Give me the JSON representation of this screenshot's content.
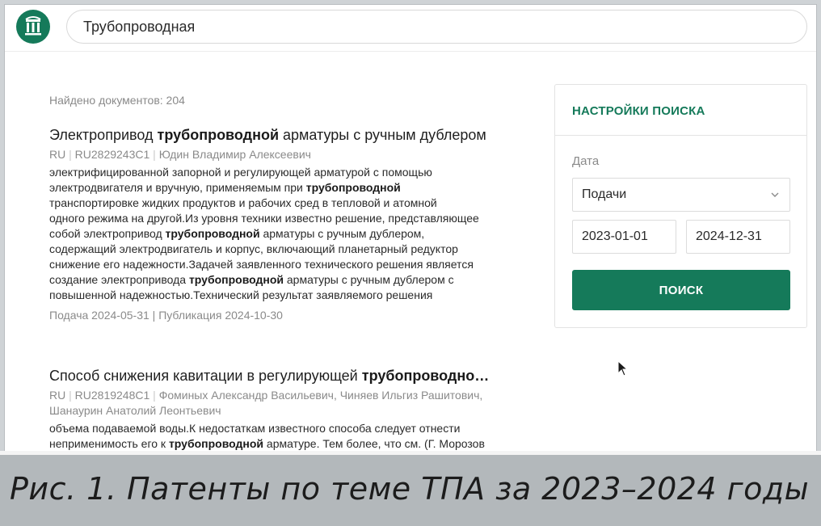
{
  "search": {
    "query": "Трубопроводная"
  },
  "results_count": "Найдено документов: 204",
  "results": [
    {
      "title_before": "Электропривод ",
      "title_bold": "трубопроводной",
      "title_after": " арматуры с ручным дублером",
      "country": "RU",
      "number": "RU2829243C1",
      "authors": "Юдин Владимир Алексеевич",
      "snippet_lines": [
        [
          "электрифицированной запорной и регулирующей арматурой с помощью",
          "",
          ""
        ],
        [
          "электродвигателя и вручную, применяемым при ",
          "трубопроводной",
          ""
        ],
        [
          "транспортировке жидких продуктов и рабочих сред в тепловой и атомной",
          "",
          ""
        ],
        [
          "одного режима на другой.Из уровня техники известно решение, представляющее",
          "",
          ""
        ],
        [
          "собой электропривод ",
          "трубопроводной",
          " арматуры с ручным дублером,"
        ],
        [
          "содержащий электродвигатель и корпус, включающий планетарный редуктор",
          "",
          ""
        ],
        [
          "снижение его надежности.Задачей заявленного технического решения является",
          "",
          ""
        ],
        [
          "создание электропривода ",
          "трубопроводной",
          " арматуры с ручным дублером с"
        ],
        [
          "повышенной надежностью.Технический результат заявляемого решения",
          "",
          ""
        ]
      ],
      "filed": "Подача 2024-05-31",
      "published": "Публикация 2024-10-30"
    },
    {
      "title_before": "Способ снижения кавитации в регулирующей ",
      "title_bold": "трубопроводно…",
      "title_after": "",
      "country": "RU",
      "number": "RU2819248C1",
      "authors_line1": "Фоминых Александр Васильевич, Чиняев Ильгиз Рашитович,",
      "authors_line2": "Шанаурин Анатолий Леонтьевич",
      "snippet_lines": [
        [
          "объема подаваемой воды.К недостаткам известного способа следует отнести",
          "",
          ""
        ],
        [
          "неприменимость его к ",
          "трубопроводной",
          " арматуре. Тем более, что см. (Г. Морозов"
        ]
      ]
    }
  ],
  "panel": {
    "title": "НАСТРОЙКИ ПОИСКА",
    "date_label": "Дата",
    "date_type": "Подачи",
    "date_from": "2023-01-01",
    "date_to": "2024-12-31",
    "search_button": "ПОИСК"
  },
  "caption": "Рис. 1. Патенты по теме ТПА за 2023–2024 годы",
  "colors": {
    "accent": "#157a5a",
    "muted_text": "#8a8a8a",
    "caption_bar": "#b3b8bb"
  }
}
